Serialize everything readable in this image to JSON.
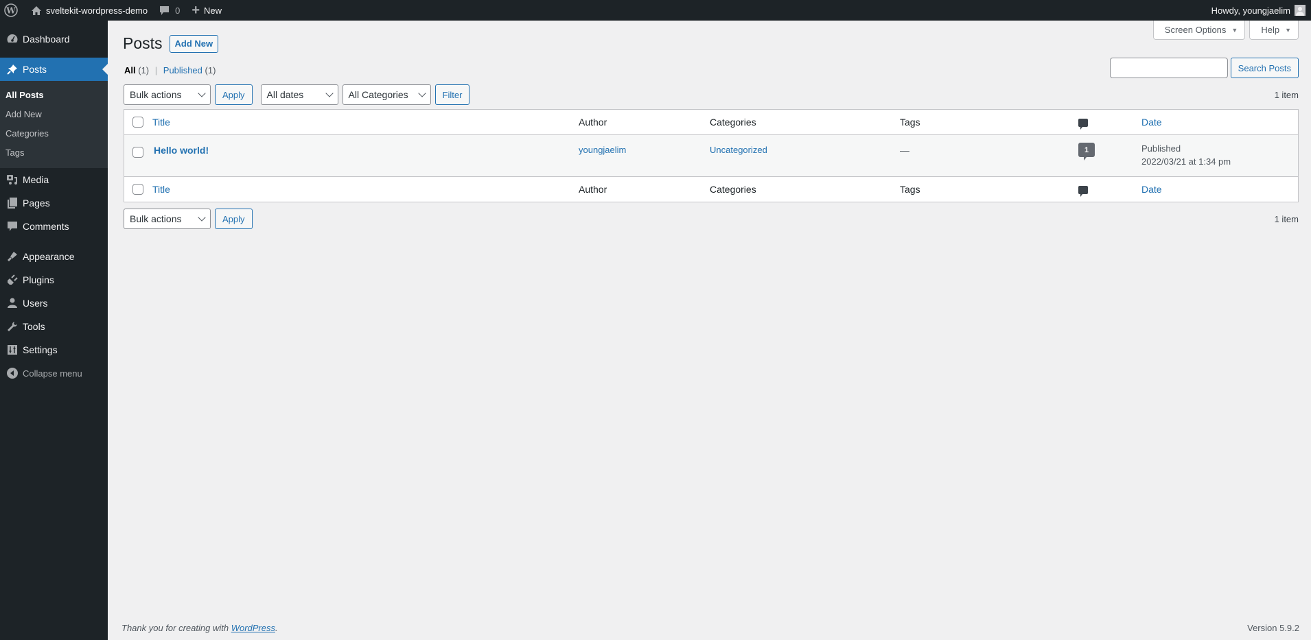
{
  "adminbar": {
    "site_name": "sveltekit-wordpress-demo",
    "comments_count": "0",
    "new_label": "New",
    "howdy": "Howdy, youngjaelim"
  },
  "sidebar": {
    "items": [
      {
        "label": "Dashboard",
        "icon": "dashboard-icon"
      },
      {
        "label": "Posts",
        "icon": "pin-icon",
        "current": true,
        "submenu": [
          "All Posts",
          "Add New",
          "Categories",
          "Tags"
        ]
      },
      {
        "label": "Media",
        "icon": "media-icon"
      },
      {
        "label": "Pages",
        "icon": "pages-icon"
      },
      {
        "label": "Comments",
        "icon": "comments-icon"
      },
      {
        "label": "Appearance",
        "icon": "brush-icon"
      },
      {
        "label": "Plugins",
        "icon": "plug-icon"
      },
      {
        "label": "Users",
        "icon": "user-icon"
      },
      {
        "label": "Tools",
        "icon": "wrench-icon"
      },
      {
        "label": "Settings",
        "icon": "settings-icon"
      }
    ],
    "collapse_label": "Collapse menu"
  },
  "header": {
    "screen_options": "Screen Options",
    "help": "Help",
    "title": "Posts",
    "add_new": "Add New"
  },
  "views": {
    "all_label": "All",
    "all_count": "(1)",
    "published_label": "Published",
    "published_count": "(1)"
  },
  "search": {
    "value": "",
    "button": "Search Posts"
  },
  "tablenav_top": {
    "bulk_actions": "Bulk actions",
    "apply": "Apply",
    "dates": "All dates",
    "categories": "All Categories",
    "filter": "Filter",
    "count": "1 item"
  },
  "table": {
    "columns": [
      "Title",
      "Author",
      "Categories",
      "Tags",
      "Comments",
      "Date"
    ],
    "rows": [
      {
        "title": "Hello world!",
        "author": "youngjaelim",
        "categories": "Uncategorized",
        "tags": "—",
        "comments": "1",
        "status": "Published",
        "date": "2022/03/21 at 1:34 pm"
      }
    ]
  },
  "tablenav_bottom": {
    "bulk_actions": "Bulk actions",
    "apply": "Apply",
    "count": "1 item"
  },
  "footer": {
    "thanks_prefix": "Thank you for creating with ",
    "wp_link": "WordPress",
    "thanks_suffix": ".",
    "version": "Version 5.9.2"
  }
}
